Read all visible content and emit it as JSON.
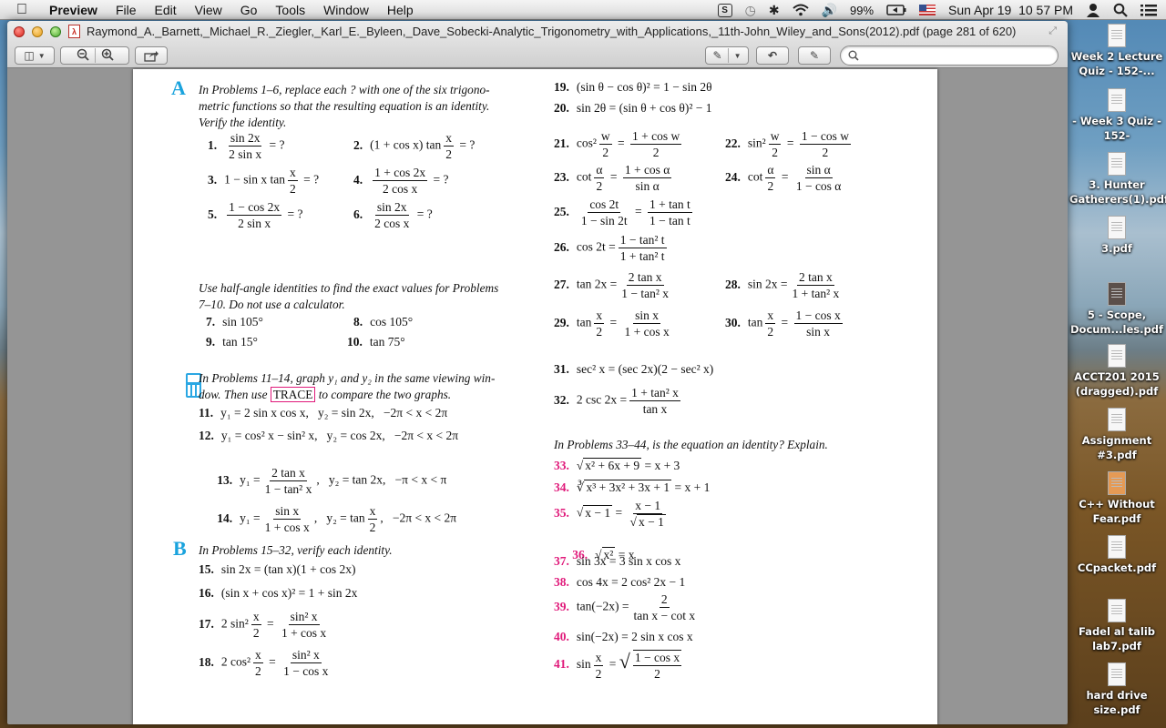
{
  "menubar": {
    "app_name": "Preview",
    "menus": [
      "File",
      "Edit",
      "View",
      "Go",
      "Tools",
      "Window",
      "Help"
    ],
    "status": {
      "battery": "99%",
      "datetime": "Sun Apr 19  10 57 PM"
    },
    "icons": [
      "apple-icon",
      "skype-icon",
      "time-machine-icon",
      "bluetooth-icon",
      "wifi-icon",
      "volume-icon",
      "battery-icon",
      "us-flag-icon",
      "user-icon",
      "spotlight-icon",
      "notification-list-icon"
    ]
  },
  "window": {
    "title": "Raymond_A._Barnett,_Michael_R._Ziegler,_Karl_E._Byleen,_Dave_Sobecki-Analytic_Trigonometry_with_Applications,_11th-John_Wiley_and_Sons(2012).pdf (page 281 of 620)",
    "search_placeholder": "",
    "search_value": ""
  },
  "document": {
    "section_a": {
      "letter": "A",
      "instruction": "In Problems 1–6, replace each ? with one of the six trigonometric functions so that the resulting equation is an identity. Verify the identity.",
      "instruction_lines": [
        "In Problems 1–6, replace each ? with one of the six trigono-",
        "metric functions so that the resulting equation is an identity.",
        "Verify the identity."
      ],
      "problems": [
        {
          "num": "1.",
          "num_expr": "sin 2x",
          "den_expr": "2 sin x",
          "tail": "= ?"
        },
        {
          "num": "2.",
          "pre": "(1 + cos x) tan",
          "num_expr": "x",
          "den_expr": "2",
          "tail": "= ?"
        },
        {
          "num": "3.",
          "pre": "1 − sin x tan",
          "num_expr": "x",
          "den_expr": "2",
          "tail": "= ?"
        },
        {
          "num": "4.",
          "num_expr": "1 + cos 2x",
          "den_expr": "2 cos x",
          "tail": "= ?"
        },
        {
          "num": "5.",
          "num_expr": "1 − cos 2x",
          "den_expr": "2 sin x",
          "tail": "= ?"
        },
        {
          "num": "6.",
          "num_expr": "sin 2x",
          "den_expr": "2 cos x",
          "tail": "= ?"
        }
      ],
      "half_angle_instruction_lines": [
        "Use half-angle identities to find the exact values for Problems",
        "7–10. Do not use a calculator."
      ],
      "half_angle_problems": [
        {
          "num": "7.",
          "expr": "sin 105°"
        },
        {
          "num": "8.",
          "expr": "cos 105°"
        },
        {
          "num": "9.",
          "expr": "tan 15°"
        },
        {
          "num": "10.",
          "expr": "tan 75°"
        }
      ],
      "graph_instruction_line1": "In Problems 11–14, graph y₁ and y₂ in the same viewing win-",
      "graph_instruction_line2_pre": "dow. Then use",
      "trace_label": "TRACE",
      "graph_instruction_line2_post": "to compare the two graphs.",
      "graph_problems": [
        {
          "num": "11.",
          "expr": "y₁ = 2 sin x cos x,   y₂ = sin 2x,   −2π < x < 2π"
        },
        {
          "num": "12.",
          "expr": "y₁ = cos² x − sin² x,   y₂ = cos 2x,   −2π < x < 2π"
        },
        {
          "num": "13.",
          "pre": "y₁ =",
          "num_expr": "2 tan x",
          "den_expr": "1 − tan² x",
          "tail": ",   y₂ = tan 2x,   −π < x < π"
        },
        {
          "num": "14.",
          "pre": "y₁ =",
          "num_expr": "sin x",
          "den_expr": "1 + cos x",
          "tail": ",   y₂ = tan",
          "num_expr2": "x",
          "den_expr2": "2",
          "tail2": ",   −2π < x < 2π"
        }
      ]
    },
    "section_b": {
      "letter": "B",
      "instruction": "In Problems 15–32, verify each identity.",
      "problems": [
        {
          "num": "15.",
          "expr": "sin 2x = (tan x)(1 + cos 2x)"
        },
        {
          "num": "16.",
          "expr": "(sin x + cos x)² = 1 + sin 2x"
        },
        {
          "num": "17.",
          "pre": "2 sin²",
          "num_expr": "x",
          "den_expr": "2",
          "mid": "=",
          "num_expr2": "sin² x",
          "den_expr2": "1 + cos x"
        },
        {
          "num": "18.",
          "pre": "2 cos²",
          "num_expr": "x",
          "den_expr": "2",
          "mid": "=",
          "num_expr2": "sin² x",
          "den_expr2": "1 − cos x"
        },
        {
          "num": "19.",
          "expr": "(sin θ − cos θ)² = 1 − sin 2θ"
        },
        {
          "num": "20.",
          "expr": "sin 2θ = (sin θ + cos θ)² − 1"
        },
        {
          "num": "21.",
          "pre": "cos²",
          "num_expr": "w",
          "den_expr": "2",
          "mid": "=",
          "num_expr2": "1 + cos w",
          "den_expr2": "2"
        },
        {
          "num": "22.",
          "pre": "sin²",
          "num_expr": "w",
          "den_expr": "2",
          "mid": "=",
          "num_expr2": "1 − cos w",
          "den_expr2": "2"
        },
        {
          "num": "23.",
          "pre": "cot",
          "num_expr": "α",
          "den_expr": "2",
          "mid": "=",
          "num_expr2": "1 + cos α",
          "den_expr2": "sin α"
        },
        {
          "num": "24.",
          "pre": "cot",
          "num_expr": "α",
          "den_expr": "2",
          "mid": "=",
          "num_expr2": "sin α",
          "den_expr2": "1 − cos α"
        },
        {
          "num": "25.",
          "num_expr": "cos 2t",
          "den_expr": "1 − sin 2t",
          "mid": "=",
          "num_expr2": "1 + tan t",
          "den_expr2": "1 − tan t"
        },
        {
          "num": "26.",
          "pre": "cos 2t =",
          "num_expr": "1 − tan² t",
          "den_expr": "1 + tan² t"
        },
        {
          "num": "27.",
          "pre": "tan 2x =",
          "num_expr": "2 tan x",
          "den_expr": "1 − tan² x"
        },
        {
          "num": "28.",
          "pre": "sin 2x =",
          "num_expr": "2 tan x",
          "den_expr": "1 + tan² x"
        },
        {
          "num": "29.",
          "pre": "tan",
          "num_expr": "x",
          "den_expr": "2",
          "mid": "=",
          "num_expr2": "sin x",
          "den_expr2": "1 + cos x"
        },
        {
          "num": "30.",
          "pre": "tan",
          "num_expr": "x",
          "den_expr": "2",
          "mid": "=",
          "num_expr2": "1 − cos x",
          "den_expr2": "sin x"
        },
        {
          "num": "31.",
          "expr": "sec² x = (sec 2x)(2 − sec² x)"
        },
        {
          "num": "32.",
          "pre": "2 csc 2x =",
          "num_expr": "1 + tan² x",
          "den_expr": "tan x"
        }
      ]
    },
    "section_c": {
      "instruction": "In Problems 33–44, is the equation an identity? Explain.",
      "problems": [
        {
          "num": "33.",
          "radical": "√",
          "radicand": "x² + 6x + 9",
          "tail": "= x + 3"
        },
        {
          "num": "34.",
          "radical": "∛",
          "radicand": "x³ + 3x² + 3x + 1",
          "tail": "= x + 1"
        },
        {
          "num": "35.",
          "radical": "√",
          "radicand": "x − 1",
          "mid": "=",
          "num_expr": "x − 1",
          "den_radical": "√",
          "den_radicand": "x − 1"
        },
        {
          "num": "36.",
          "radical": "√",
          "radicand": "x²",
          "tail": " = x"
        },
        {
          "num": "37.",
          "expr": "sin 3x = 3 sin x cos x"
        },
        {
          "num": "38.",
          "expr": "cos 4x = 2 cos² 2x − 1"
        },
        {
          "num": "39.",
          "pre": "tan(−2x) =",
          "num_expr": "2",
          "den_expr": "tan x − cot x"
        },
        {
          "num": "40.",
          "expr": "sin(−2x) = 2 sin x cos x"
        },
        {
          "num": "41.",
          "pre": "sin",
          "num_expr": "x",
          "den_expr": "2",
          "mid": "=",
          "radical": "√",
          "num_expr2": "1 − cos x",
          "den_expr2": "2"
        }
      ]
    }
  },
  "desktop": {
    "items": [
      {
        "label": "Week 2 Lecture Quiz - 152-..."
      },
      {
        "label": "- Week 3 Quiz - 152-"
      },
      {
        "label": "3. Hunter Gatherers(1).pdf"
      },
      {
        "label": "3.pdf"
      },
      {
        "label": "5 - Scope, Docum...les.pdf"
      },
      {
        "label": "ACCT201  2015 (dragged).pdf"
      },
      {
        "label": "Assignment #3.pdf"
      },
      {
        "label": "C++ Without Fear.pdf"
      },
      {
        "label": "CCpacket.pdf"
      },
      {
        "label": "Fadel al talib lab7.pdf"
      },
      {
        "label": "hard drive size.pdf"
      }
    ]
  },
  "colors": {
    "section_letter": "#1aa3dd",
    "pink_number": "#e0197a"
  }
}
